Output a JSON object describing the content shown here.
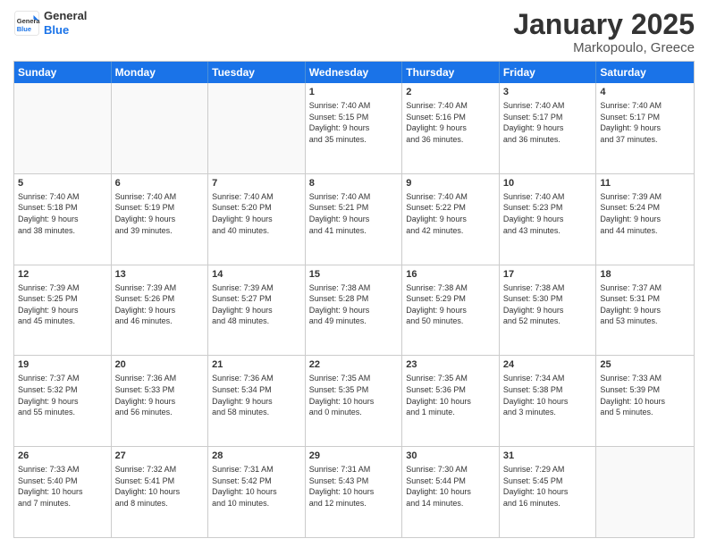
{
  "logo": {
    "general": "General",
    "blue": "Blue"
  },
  "title": "January 2025",
  "location": "Markopoulo, Greece",
  "weekdays": [
    "Sunday",
    "Monday",
    "Tuesday",
    "Wednesday",
    "Thursday",
    "Friday",
    "Saturday"
  ],
  "rows": [
    [
      {
        "day": "",
        "info": ""
      },
      {
        "day": "",
        "info": ""
      },
      {
        "day": "",
        "info": ""
      },
      {
        "day": "1",
        "info": "Sunrise: 7:40 AM\nSunset: 5:15 PM\nDaylight: 9 hours\nand 35 minutes."
      },
      {
        "day": "2",
        "info": "Sunrise: 7:40 AM\nSunset: 5:16 PM\nDaylight: 9 hours\nand 36 minutes."
      },
      {
        "day": "3",
        "info": "Sunrise: 7:40 AM\nSunset: 5:17 PM\nDaylight: 9 hours\nand 36 minutes."
      },
      {
        "day": "4",
        "info": "Sunrise: 7:40 AM\nSunset: 5:17 PM\nDaylight: 9 hours\nand 37 minutes."
      }
    ],
    [
      {
        "day": "5",
        "info": "Sunrise: 7:40 AM\nSunset: 5:18 PM\nDaylight: 9 hours\nand 38 minutes."
      },
      {
        "day": "6",
        "info": "Sunrise: 7:40 AM\nSunset: 5:19 PM\nDaylight: 9 hours\nand 39 minutes."
      },
      {
        "day": "7",
        "info": "Sunrise: 7:40 AM\nSunset: 5:20 PM\nDaylight: 9 hours\nand 40 minutes."
      },
      {
        "day": "8",
        "info": "Sunrise: 7:40 AM\nSunset: 5:21 PM\nDaylight: 9 hours\nand 41 minutes."
      },
      {
        "day": "9",
        "info": "Sunrise: 7:40 AM\nSunset: 5:22 PM\nDaylight: 9 hours\nand 42 minutes."
      },
      {
        "day": "10",
        "info": "Sunrise: 7:40 AM\nSunset: 5:23 PM\nDaylight: 9 hours\nand 43 minutes."
      },
      {
        "day": "11",
        "info": "Sunrise: 7:39 AM\nSunset: 5:24 PM\nDaylight: 9 hours\nand 44 minutes."
      }
    ],
    [
      {
        "day": "12",
        "info": "Sunrise: 7:39 AM\nSunset: 5:25 PM\nDaylight: 9 hours\nand 45 minutes."
      },
      {
        "day": "13",
        "info": "Sunrise: 7:39 AM\nSunset: 5:26 PM\nDaylight: 9 hours\nand 46 minutes."
      },
      {
        "day": "14",
        "info": "Sunrise: 7:39 AM\nSunset: 5:27 PM\nDaylight: 9 hours\nand 48 minutes."
      },
      {
        "day": "15",
        "info": "Sunrise: 7:38 AM\nSunset: 5:28 PM\nDaylight: 9 hours\nand 49 minutes."
      },
      {
        "day": "16",
        "info": "Sunrise: 7:38 AM\nSunset: 5:29 PM\nDaylight: 9 hours\nand 50 minutes."
      },
      {
        "day": "17",
        "info": "Sunrise: 7:38 AM\nSunset: 5:30 PM\nDaylight: 9 hours\nand 52 minutes."
      },
      {
        "day": "18",
        "info": "Sunrise: 7:37 AM\nSunset: 5:31 PM\nDaylight: 9 hours\nand 53 minutes."
      }
    ],
    [
      {
        "day": "19",
        "info": "Sunrise: 7:37 AM\nSunset: 5:32 PM\nDaylight: 9 hours\nand 55 minutes."
      },
      {
        "day": "20",
        "info": "Sunrise: 7:36 AM\nSunset: 5:33 PM\nDaylight: 9 hours\nand 56 minutes."
      },
      {
        "day": "21",
        "info": "Sunrise: 7:36 AM\nSunset: 5:34 PM\nDaylight: 9 hours\nand 58 minutes."
      },
      {
        "day": "22",
        "info": "Sunrise: 7:35 AM\nSunset: 5:35 PM\nDaylight: 10 hours\nand 0 minutes."
      },
      {
        "day": "23",
        "info": "Sunrise: 7:35 AM\nSunset: 5:36 PM\nDaylight: 10 hours\nand 1 minute."
      },
      {
        "day": "24",
        "info": "Sunrise: 7:34 AM\nSunset: 5:38 PM\nDaylight: 10 hours\nand 3 minutes."
      },
      {
        "day": "25",
        "info": "Sunrise: 7:33 AM\nSunset: 5:39 PM\nDaylight: 10 hours\nand 5 minutes."
      }
    ],
    [
      {
        "day": "26",
        "info": "Sunrise: 7:33 AM\nSunset: 5:40 PM\nDaylight: 10 hours\nand 7 minutes."
      },
      {
        "day": "27",
        "info": "Sunrise: 7:32 AM\nSunset: 5:41 PM\nDaylight: 10 hours\nand 8 minutes."
      },
      {
        "day": "28",
        "info": "Sunrise: 7:31 AM\nSunset: 5:42 PM\nDaylight: 10 hours\nand 10 minutes."
      },
      {
        "day": "29",
        "info": "Sunrise: 7:31 AM\nSunset: 5:43 PM\nDaylight: 10 hours\nand 12 minutes."
      },
      {
        "day": "30",
        "info": "Sunrise: 7:30 AM\nSunset: 5:44 PM\nDaylight: 10 hours\nand 14 minutes."
      },
      {
        "day": "31",
        "info": "Sunrise: 7:29 AM\nSunset: 5:45 PM\nDaylight: 10 hours\nand 16 minutes."
      },
      {
        "day": "",
        "info": ""
      }
    ]
  ]
}
